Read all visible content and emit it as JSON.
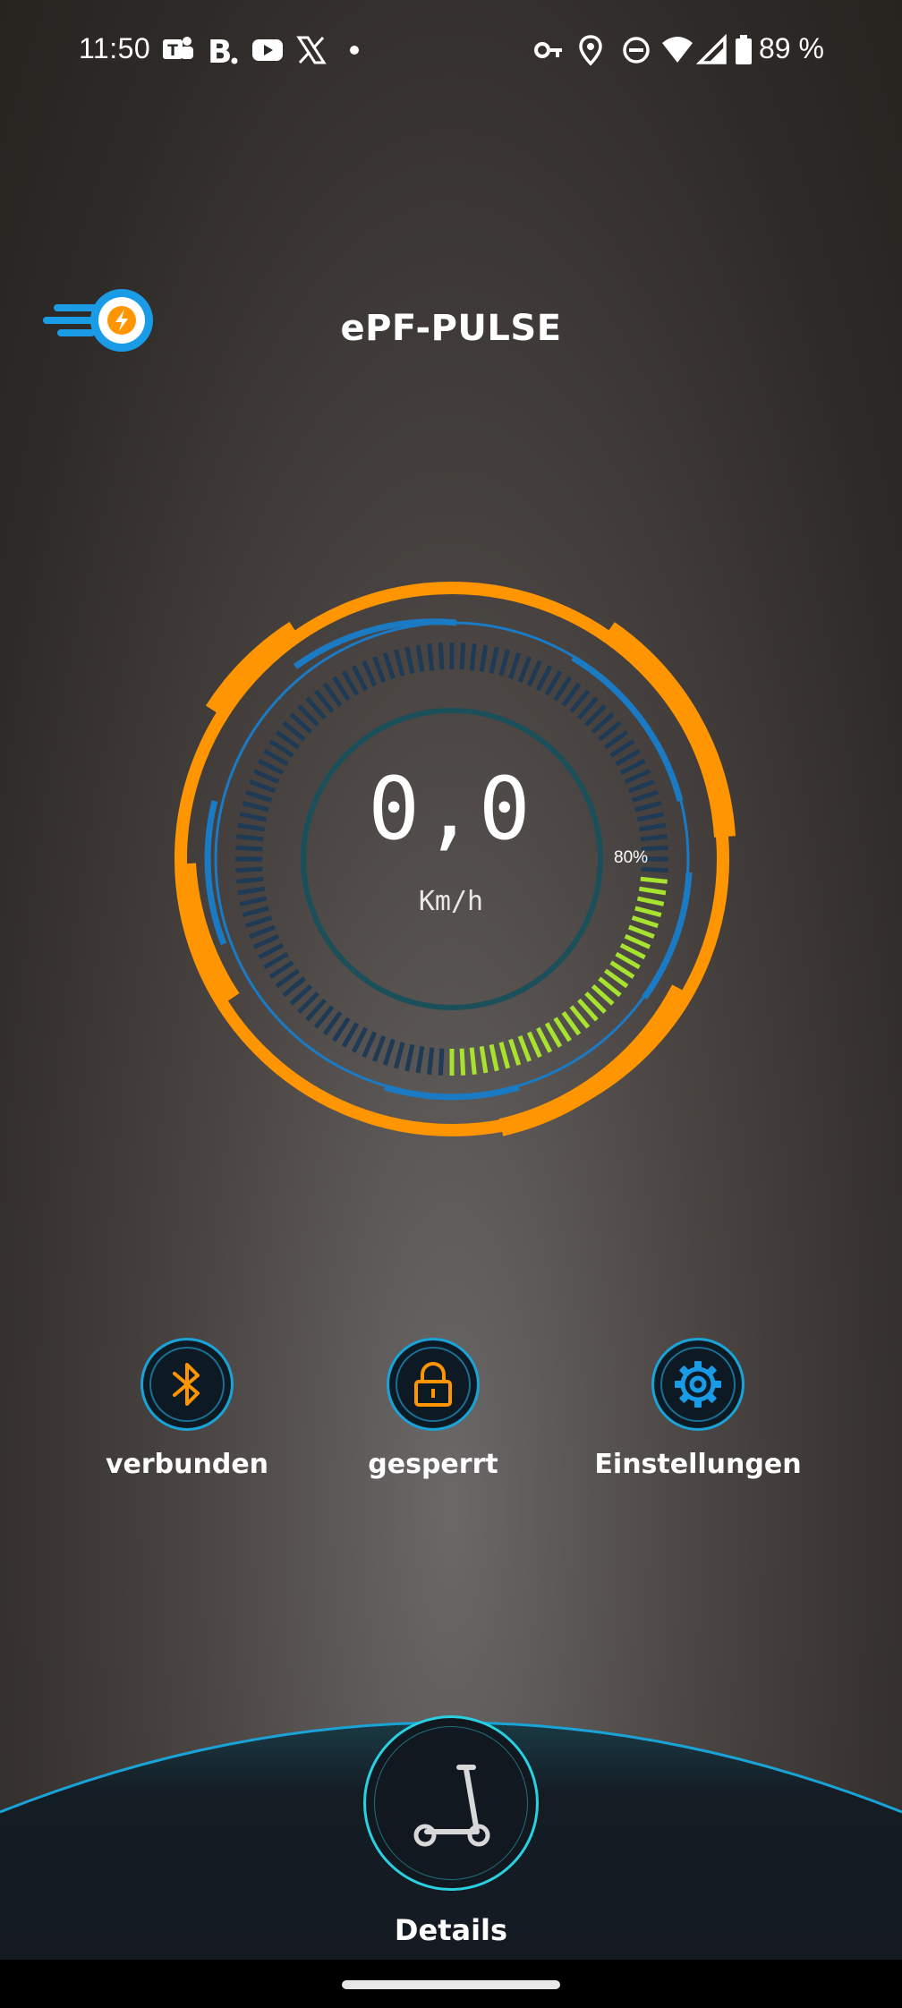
{
  "status_bar": {
    "time": "11:50",
    "battery_percent": "89 %",
    "icons_left": [
      "teams-icon",
      "booking-icon",
      "youtube-icon",
      "x-icon",
      "dot-icon"
    ],
    "icons_right": [
      "vpn-key-icon",
      "location-icon",
      "dnd-icon",
      "wifi-icon",
      "signal-icon",
      "battery-icon"
    ]
  },
  "header": {
    "title": "ePF-PULSE",
    "logo_icon": "speed-lightning-logo"
  },
  "gauge": {
    "speed": "0,0",
    "unit": "Km/h",
    "battery_label": "80%",
    "battery_level": 0.8,
    "colors": {
      "outer_ring": "#ff9500",
      "blue_ring": "#1a7ac4",
      "inner_ring": "#1b4f5a",
      "tick_inactive": "#1e3a55",
      "tick_active": "#a6e22e"
    }
  },
  "actions": [
    {
      "label": "verbunden",
      "icon": "bluetooth-icon"
    },
    {
      "label": "gesperrt",
      "icon": "lock-icon"
    },
    {
      "label": "Einstellungen",
      "icon": "gear-icon"
    }
  ],
  "bottom": {
    "details_label": "Details",
    "details_icon": "scooter-icon"
  },
  "colors": {
    "accent_orange": "#ff9500",
    "accent_cyan": "#2ad0e0",
    "accent_blue": "#1aa3d6"
  }
}
